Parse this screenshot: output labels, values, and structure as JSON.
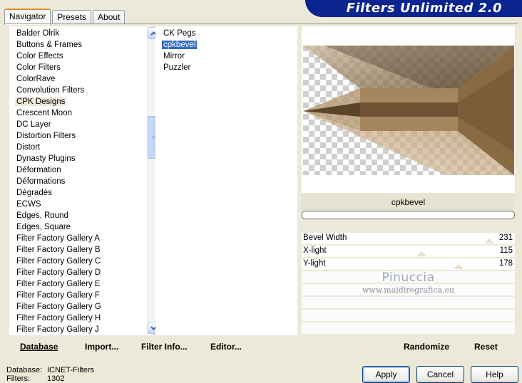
{
  "app": {
    "title": "Filters Unlimited 2.0",
    "tabs": [
      {
        "label": "Navigator",
        "active": true
      },
      {
        "label": "Presets",
        "active": false
      },
      {
        "label": "About",
        "active": false
      }
    ]
  },
  "categories": {
    "items": [
      "Balder Olrik",
      "Buttons & Frames",
      "Color Effects",
      "Color Filters",
      "ColorRave",
      "Convolution Filters",
      "CPK Designs",
      "Crescent Moon",
      "DC Layer",
      "Distortion Filters",
      "Distort",
      "Dynasty Plugins",
      "Déformation",
      "Déformations",
      "Dégradés",
      "ECWS",
      "Edges, Round",
      "Edges, Square",
      "Filter Factory Gallery A",
      "Filter Factory Gallery B",
      "Filter Factory Gallery C",
      "Filter Factory Gallery D",
      "Filter Factory Gallery E",
      "Filter Factory Gallery F",
      "Filter Factory Gallery G",
      "Filter Factory Gallery H",
      "Filter Factory Gallery J"
    ],
    "selected": "CPK Designs"
  },
  "filters": {
    "items": [
      "CK Pegs",
      "cpkbevel",
      "Mirror",
      "Puzzler"
    ],
    "selected": "cpkbevel"
  },
  "toolbar": {
    "database": "Database",
    "import": "Import...",
    "filter_info": "Filter Info...",
    "editor": "Editor...",
    "randomize": "Randomize",
    "reset": "Reset"
  },
  "preview": {
    "filter_name": "cpkbevel",
    "progress": 0
  },
  "sliders": [
    {
      "label": "Bevel Width",
      "value": "231",
      "fraction": 0.906
    },
    {
      "label": "X-light",
      "value": "115",
      "fraction": 0.451
    },
    {
      "label": "Y-light",
      "value": "178",
      "fraction": 0.698
    }
  ],
  "watermark": {
    "line1": "Pinuccia",
    "line2": "www.maidiregrafica.eu"
  },
  "status": {
    "database_label": "Database:",
    "database_value": "ICNET-Filters",
    "filters_label": "Filters:",
    "filters_value": "1302"
  },
  "buttons": {
    "apply": "Apply",
    "cancel": "Cancel",
    "help": "Help"
  },
  "colors": {
    "banner": "#0a2490",
    "selection": "#316ac5",
    "tab_accent": "#e68b2c"
  }
}
